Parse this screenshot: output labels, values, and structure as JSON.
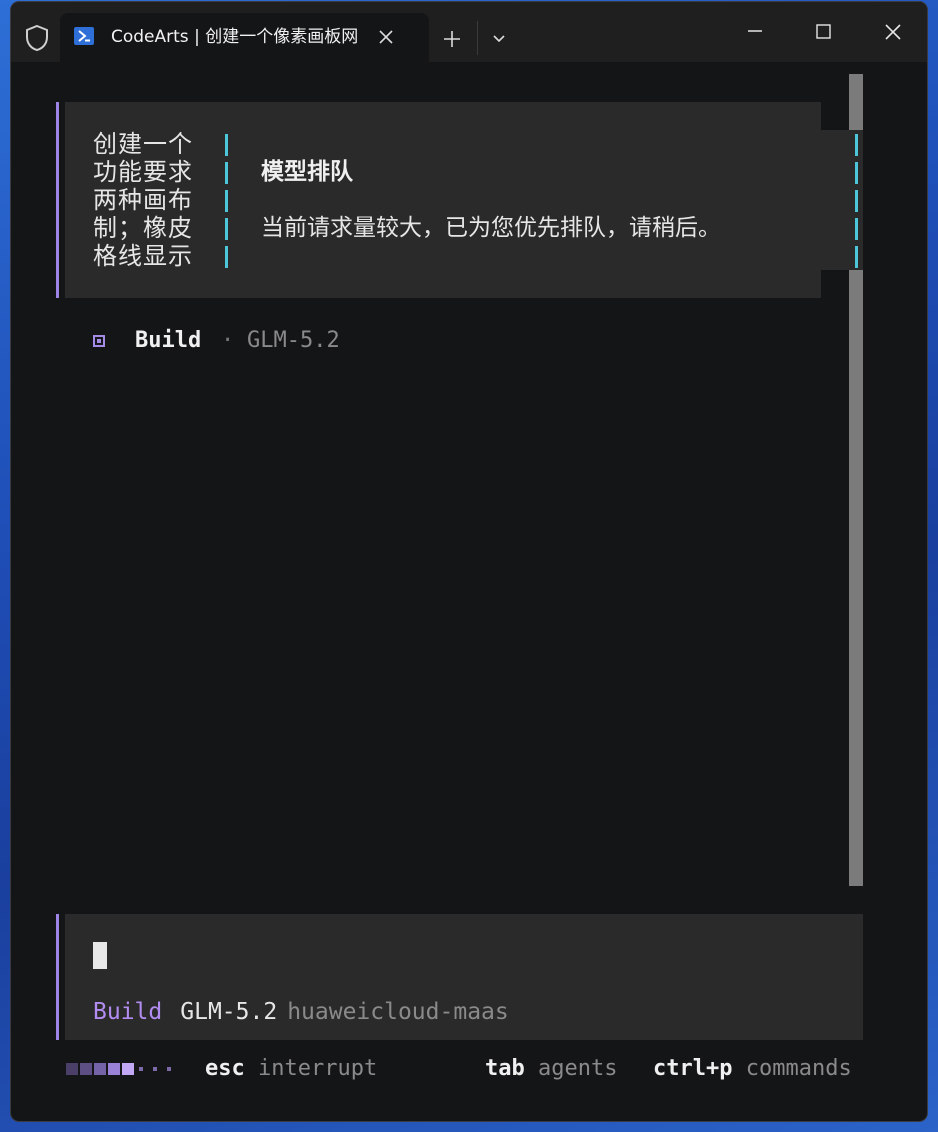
{
  "window": {
    "tab_title": "CodeArts | 创建一个像素画板网页",
    "controls": [
      "minimize",
      "maximize",
      "close"
    ]
  },
  "prompt": {
    "lines": [
      "创建一个",
      "功能要求",
      "两种画布",
      "制；橡皮",
      "格线显示"
    ]
  },
  "popup": {
    "title": "模型排队",
    "message": "当前请求量较大，已为您优先排队，请稍后。"
  },
  "status": {
    "mode": "Build",
    "separator": "·",
    "model": "GLM-5.2"
  },
  "input": {
    "agent": "Build",
    "model": "GLM-5.2",
    "provider": "huaweicloud-maas"
  },
  "footer": {
    "hints": [
      {
        "key": "esc",
        "action": "interrupt"
      },
      {
        "key": "tab",
        "action": "agents"
      },
      {
        "key": "ctrl+p",
        "action": "commands"
      }
    ]
  },
  "colors": {
    "accent_purple": "#9f84e8",
    "accent_cyan": "#4cc6d8",
    "terminal_bg": "#141517",
    "panel_bg": "#2a2a2a"
  }
}
